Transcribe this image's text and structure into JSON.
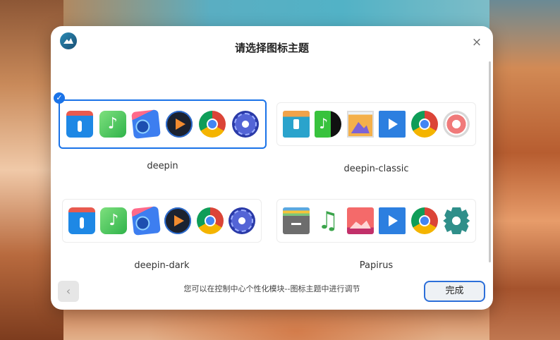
{
  "dialog": {
    "title": "请选择图标主题",
    "close_label": "×",
    "hint": "您可以在控制中心个性化模块--图标主题中进行调节",
    "back_label": "‹",
    "done_label": "完成"
  },
  "themes": [
    {
      "label": "deepin",
      "selected": true,
      "icons": [
        "files-icon",
        "music-icon",
        "photos-icon",
        "player-icon",
        "chrome-icon",
        "settings-icon"
      ]
    },
    {
      "label": "deepin-classic",
      "selected": false,
      "icons": [
        "files-icon",
        "music-icon",
        "photos-icon",
        "video-icon",
        "chrome-icon",
        "settings-icon"
      ]
    },
    {
      "label": "deepin-dark",
      "selected": false,
      "icons": [
        "files-icon",
        "music-icon",
        "photos-icon",
        "player-icon",
        "chrome-icon",
        "settings-icon"
      ]
    },
    {
      "label": "Papirus",
      "selected": false,
      "icons": [
        "files-icon",
        "music-icon",
        "photos-icon",
        "video-icon",
        "chrome-icon",
        "settings-icon"
      ]
    }
  ],
  "colors": {
    "accent": "#1a73e8",
    "dialog_bg": "#ffffff"
  }
}
